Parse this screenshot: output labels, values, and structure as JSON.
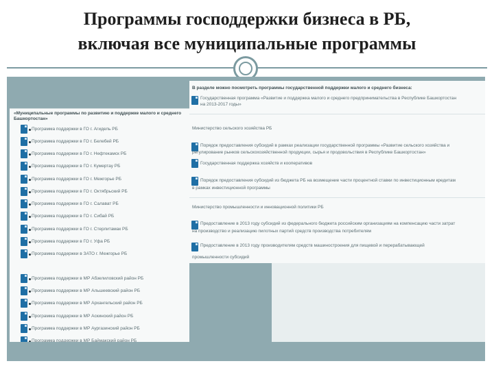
{
  "slide": {
    "title_line1": "Программы господдержки бизнеса в РБ,",
    "title_line2": "включая все муниципальные программы"
  },
  "left": {
    "header_line1": "«Муниципальные программы по развитию и поддержке малого и среднего",
    "header_line2": "Башкортостан»",
    "items": [
      "Программа поддержки в ГО г. Агидель РБ",
      "Программа поддержки в ГО г. Белебей РБ",
      "Программа поддержки в ГО г. Нефтекамск РБ",
      "Программа поддержки в ГО г. Кумертау РБ",
      "Программа поддержки в ГО г. Межгорье РБ",
      "Программа поддержки в ГО г. Октябрьский РБ",
      "Программа поддержки в ГО г. Салават РБ",
      "Программа поддержки в ГО г. Сибай РБ",
      "Программа поддержки в ГО г. Стерлитамак РБ",
      "Программа поддержки в ГО г. Уфа РБ",
      "Программа поддержки в ЗАТО г. Межгорье РБ",
      "Программа поддержки в МР Абзелиловский район РБ",
      "Программа поддержки в МР Альшеевский район РБ",
      "Программа поддержки в МР Архангельский район РБ",
      "Программа поддержки в МР Аскинский район РБ",
      "Программа поддержки в МР Аургазинский район РБ",
      "Программа поддержки в МР Баймакский район РБ"
    ]
  },
  "right": {
    "intro": "В разделе можно посмотреть программы государственной поддержки малого и среднего бизнеса:",
    "top_item_line1": "Государственная программа «Развитие и поддержка малого и среднего предпринимательства в Республике Башкортостан",
    "top_item_line2": "на 2013-2017 годы»",
    "ministry1": "Министерство сельского хозяйства РБ",
    "m1_item1_line1": "Порядок предоставления субсидий в рамках реализации государственной программы «Развитие сельского хозяйства и",
    "m1_item1_line2": "регулирование рынков сельскохозяйственной продукции, сырья и продовольствия в Республике Башкортостан»",
    "m1_item2": "Государственная поддержка хозяйств и кооперативов",
    "m1_item3_line1": "Порядок предоставления субсидий из бюджета РБ на возмещение части процентной ставки по инвестиционным кредитам",
    "m1_item3_line2": "в рамках инвестиционной программы",
    "ministry2": "Министерство промышленности и инновационной политики РБ",
    "m2_item1_line1": "Предоставление в 2013 году субсидий из федерального бюджета российским организациям на компенсацию части затрат",
    "m2_item1_line2": "на производство и реализацию пилотных партий средств производства потребителям",
    "m2_item2_line1": "Предоставление в 2013 году производителям средств машиностроения для пищевой и перерабатывающей",
    "m2_item2_line2": "промышленности субсидий"
  }
}
